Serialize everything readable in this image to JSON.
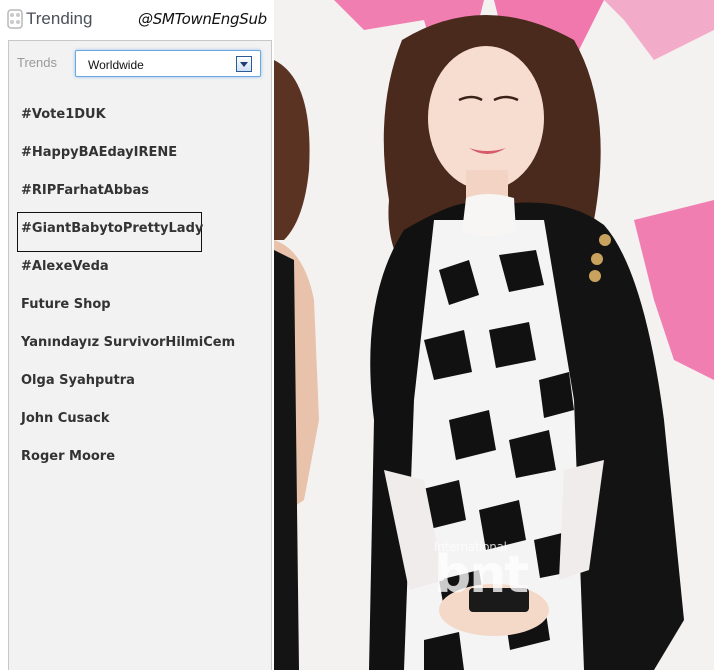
{
  "header": {
    "title": "Trending",
    "account": "@SMTownEngSub",
    "icon": "trend-logo-icon"
  },
  "controls": {
    "trends_label": "Trends",
    "location": "Worldwide",
    "dropdown_icon": "chevron-down-icon"
  },
  "trends": [
    "#Vote1DUK",
    "#HappyBAEdayIRENE",
    "#RIPFarhatAbbas",
    "#GiantBabytoPrettyLady",
    "#AlexeVeda",
    "Future Shop",
    "Yanındayız SurvivorHilmiCem",
    "Olga Syahputra",
    "John Cusack",
    "Roger Moore"
  ],
  "highlighted_index": 3,
  "photo": {
    "watermark_small": "International",
    "watermark_big": "bnt"
  },
  "colors": {
    "panel_bg": "#f2f2f2",
    "select_focus": "#6aa8e4",
    "trend_text": "#333333",
    "backdrop_pink": "#f06aa4"
  }
}
